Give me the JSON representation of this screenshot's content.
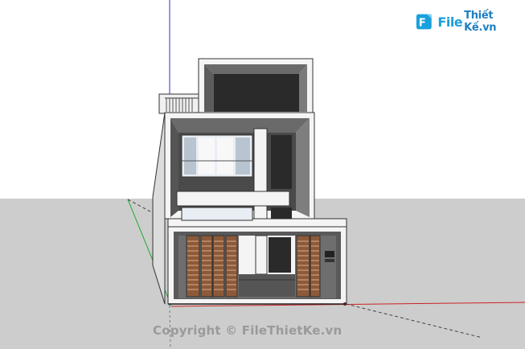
{
  "watermark": {
    "logo_file": "File",
    "logo_name": "Thiết Kế.vn",
    "copyright": "Copyright © FileThietKe.vn"
  },
  "icons": {
    "logo": "file-logo-icon"
  },
  "colors": {
    "sky": "#ffffff",
    "ground": "#cdcdcd",
    "wall_white": "#f4f4f4",
    "frame_gray": "#6a6a6a",
    "dark_panel": "#2a2a2a",
    "wood": "#8c5a3a",
    "axis_red": "#cc2222",
    "axis_green": "#22aa33",
    "axis_blue": "#2233cc"
  }
}
